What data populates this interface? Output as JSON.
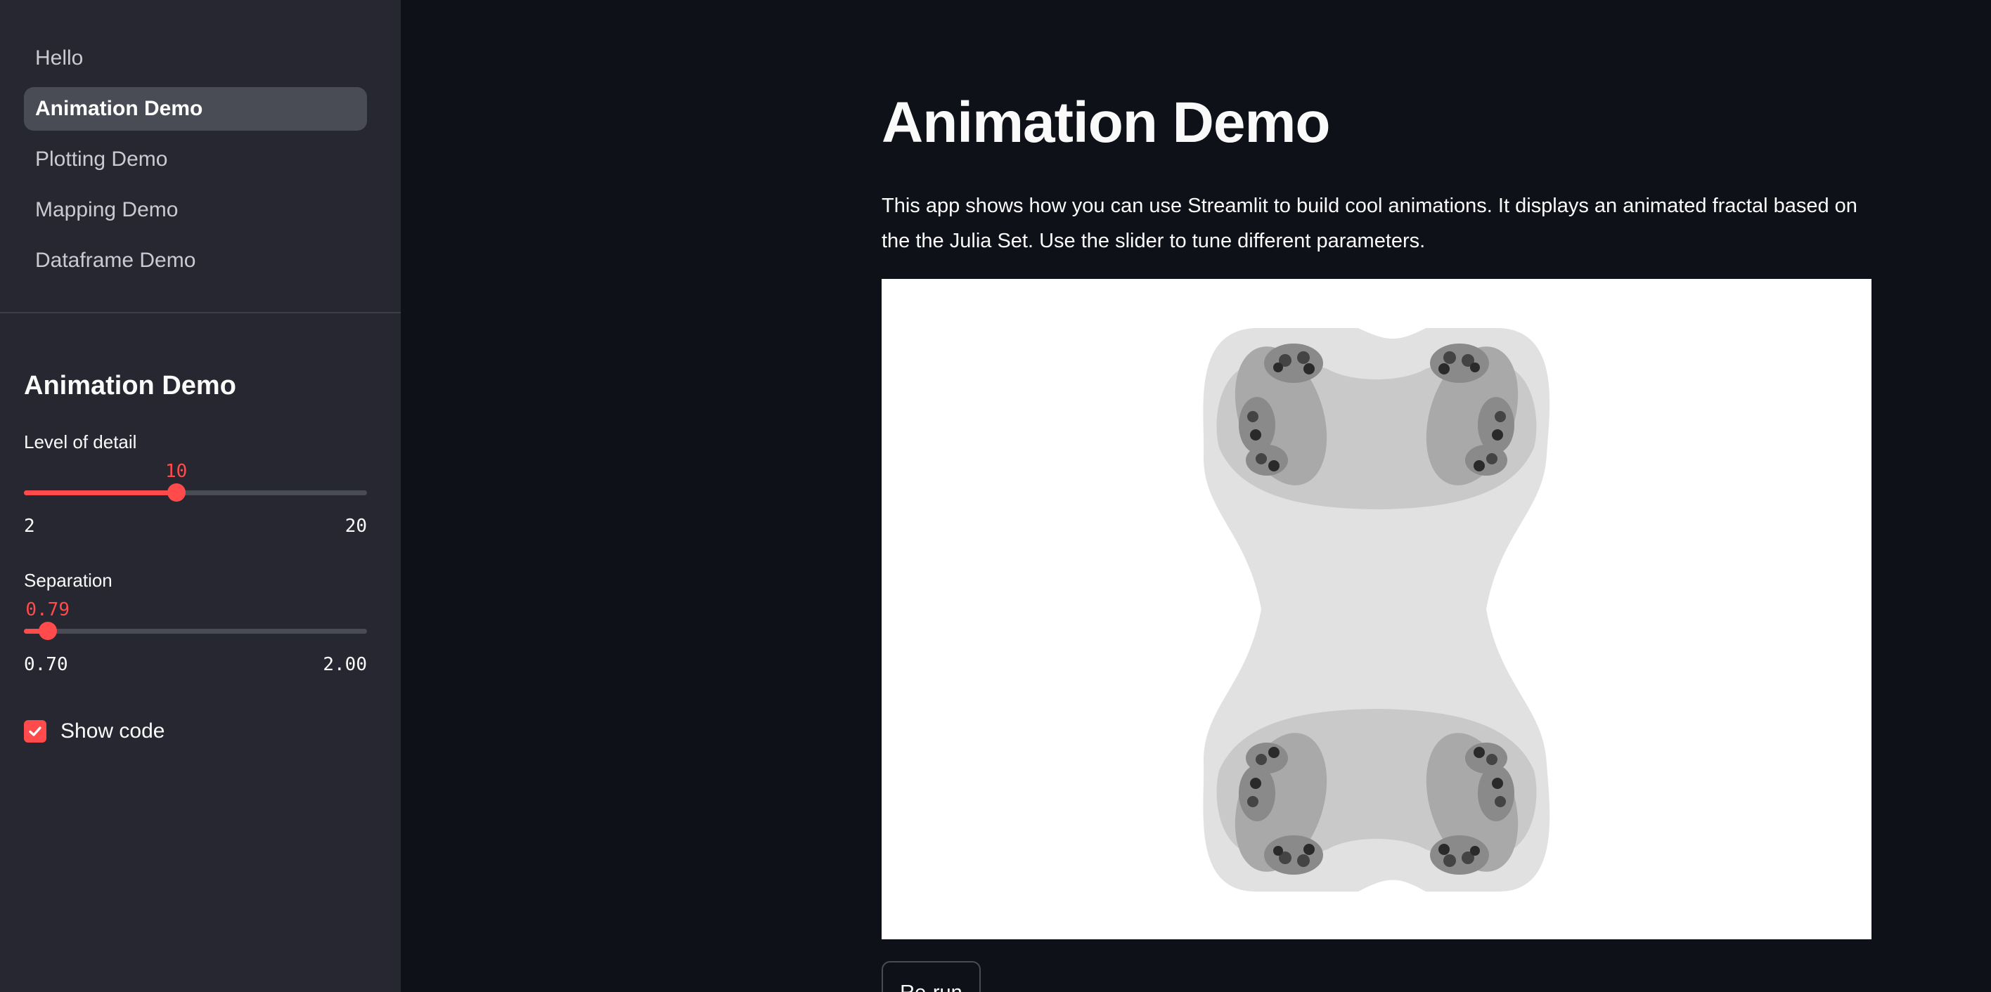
{
  "sidebar": {
    "nav": [
      {
        "label": "Hello",
        "active": false
      },
      {
        "label": "Animation Demo",
        "active": true
      },
      {
        "label": "Plotting Demo",
        "active": false
      },
      {
        "label": "Mapping Demo",
        "active": false
      },
      {
        "label": "Dataframe Demo",
        "active": false
      }
    ],
    "title": "Animation Demo",
    "detail_slider": {
      "label": "Level of detail",
      "value": "10",
      "min": "2",
      "max": "20",
      "fill_fraction": 0.444
    },
    "separation_slider": {
      "label": "Separation",
      "value": "0.79",
      "min": "0.70",
      "max": "2.00",
      "fill_fraction": 0.069
    },
    "show_code": {
      "label": "Show code",
      "checked": true
    }
  },
  "main": {
    "title": "Animation Demo",
    "description": "This app shows how you can use Streamlit to build cool animations. It displays an animated fractal based on the the Julia Set. Use the slider to tune different parameters.",
    "rerun_label": "Re-run"
  },
  "colors": {
    "accent": "#ff4b4b",
    "app_background": "#0e1117",
    "sidebar_background": "#262730",
    "active_nav_background": "#4a4c55"
  }
}
